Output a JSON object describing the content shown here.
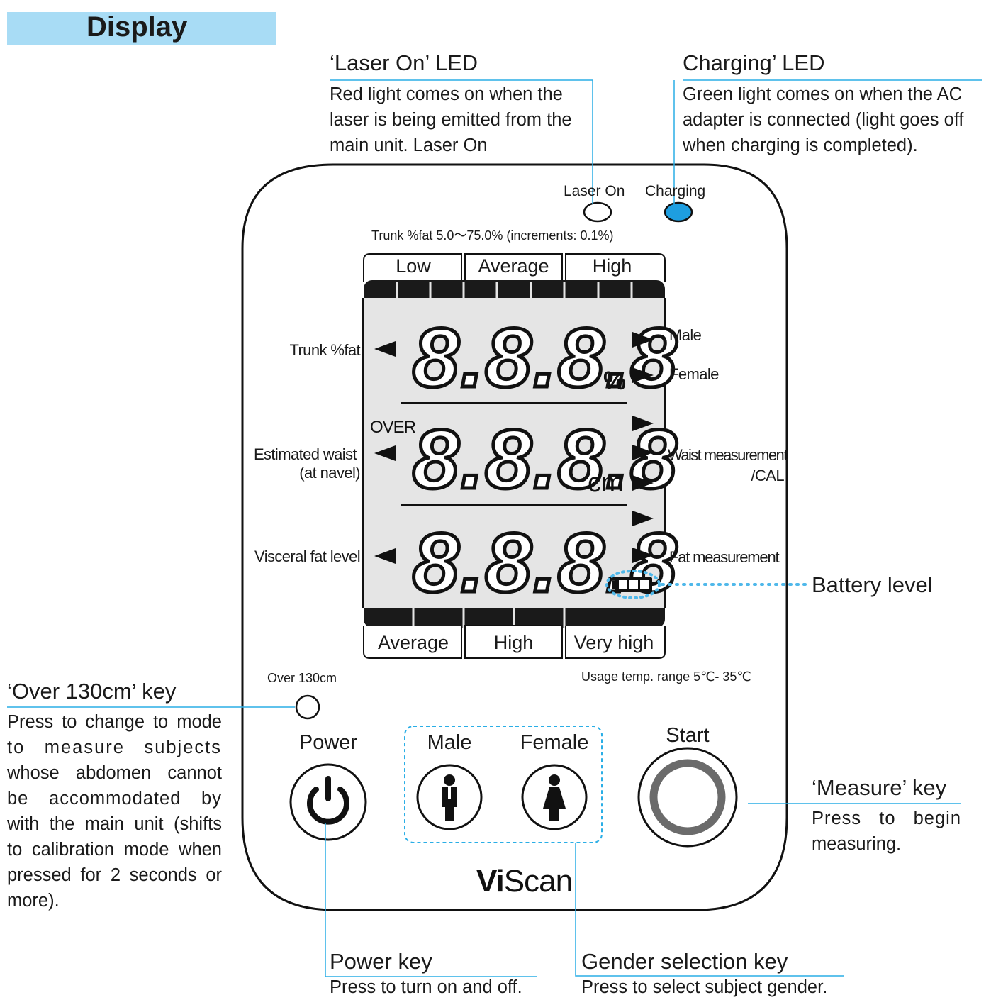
{
  "header": {
    "title": "Display"
  },
  "callouts": {
    "laser_led": {
      "title": "‘Laser On’ LED",
      "lines": [
        "Red light comes on when the",
        "laser is being emitted from the",
        "main unit. Laser On"
      ]
    },
    "charging_led": {
      "title": "Charging’ LED",
      "lines": [
        "Green light comes on when the AC",
        "adapter is connected (light goes off",
        "when charging is completed)."
      ]
    },
    "over_key": {
      "title": "‘Over 130cm’ key",
      "lines": [
        "Press to change to mode",
        "to measure subjects",
        "whose abdomen cannot",
        "be accommodated by",
        "with the main unit (shifts",
        "to calibration mode when",
        "pressed for 2 seconds or",
        "more)."
      ]
    },
    "measure_key": {
      "title": "‘Measure’ key",
      "lines": [
        "Press to begin",
        "measuring."
      ]
    },
    "power_key": {
      "title": "Power key",
      "lines": [
        "Press to turn on and off."
      ]
    },
    "gender_key": {
      "title": "Gender selection key",
      "lines": [
        "Press to select subject gender."
      ]
    },
    "battery": {
      "title": "Battery level"
    }
  },
  "device": {
    "led_laser_label": "Laser On",
    "led_charging_label": "Charging",
    "range_text": "Trunk %fat 5.0～75.0% (increments: 0.1%)",
    "top_tabs": [
      "Low",
      "Average",
      "High"
    ],
    "bottom_tabs": [
      "Average",
      "High",
      "Very high"
    ],
    "left_labels": {
      "trunk": "Trunk %fat",
      "waist_1": "Estimated waist",
      "waist_2": "(at navel)",
      "visceral": "Visceral fat level"
    },
    "right_labels": {
      "male": "Male",
      "female": "Female",
      "waist_1": "Waist measurement",
      "waist_2": "/CAL",
      "fat": "Fat measurement"
    },
    "digits": {
      "row1": "8.8.8.8",
      "row2": "8.8.8.8",
      "row3": "8.8.8.8"
    },
    "units": {
      "percent": "%",
      "cm": "cm",
      "over": "OVER"
    },
    "temp_text": "Usage temp. range 5℃- 35℃",
    "over130_label": "Over 130cm",
    "power_label": "Power",
    "male_label": "Male",
    "female_label": "Female",
    "start_label": "Start",
    "brand_vi": "Vi",
    "brand_scan": "Scan"
  },
  "colors": {
    "accent": "#2aaee6",
    "band": "#a8dcf5",
    "charging_led": "#1e9ee0",
    "lcd_bg": "#e5e5e5"
  },
  "icons": [
    "power-icon",
    "male-icon",
    "female-icon",
    "start-ring-icon",
    "battery-icon",
    "arrow-left-icon",
    "arrow-right-icon"
  ]
}
